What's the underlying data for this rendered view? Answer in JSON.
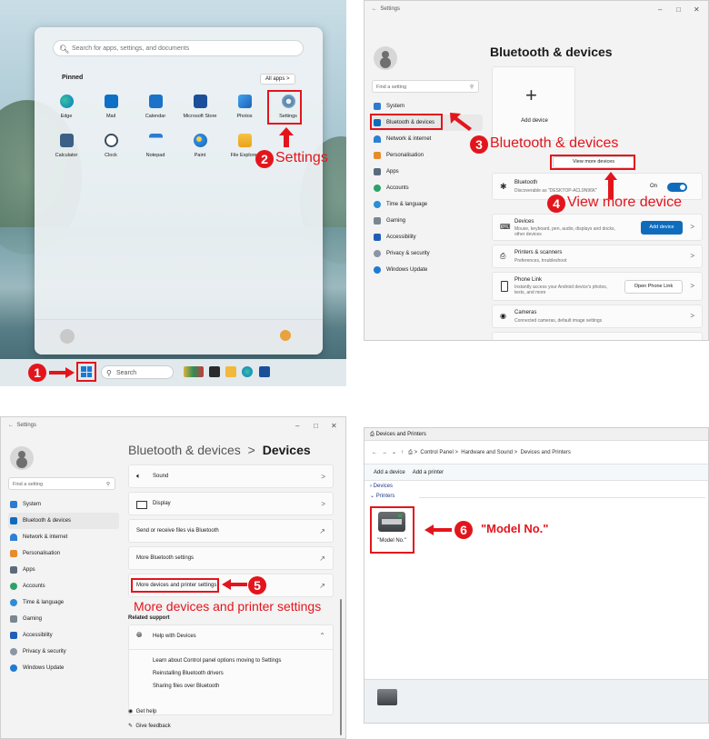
{
  "colors": {
    "accent": "#e3151c",
    "windows_blue": "#0f6cbd",
    "link_blue": "#0067c0"
  },
  "step1": {
    "start_search_placeholder": "Search for apps, settings, and documents",
    "pinned_label": "Pinned",
    "all_apps_label": "All apps",
    "pinned_apps": [
      "Edge",
      "Mail",
      "Calendar",
      "Microsoft Store",
      "Photos",
      "Settings",
      "Calculator",
      "Clock",
      "Notepad",
      "Paint",
      "File Explorer"
    ],
    "taskbar_search": "Search",
    "badge_1": "1",
    "badge_2": "2",
    "callout_2": "Settings"
  },
  "step2": {
    "window_title": "Settings",
    "page_title": "Bluetooth & devices",
    "find_setting_placeholder": "Find a setting",
    "nav_items": [
      "System",
      "Bluetooth & devices",
      "Network & internet",
      "Personalisation",
      "Apps",
      "Accounts",
      "Time & language",
      "Gaming",
      "Accessibility",
      "Privacy & security",
      "Windows Update"
    ],
    "add_device_tile": "Add device",
    "view_more_devices": "View more devices",
    "bluetooth_title": "Bluetooth",
    "bluetooth_sub": "Discoverable as \"DESKTOP-ACL9N96K\"",
    "bluetooth_state": "On",
    "devices_title": "Devices",
    "devices_sub": "Mouse, keyboard, pen, audio, displays and docks, other devices",
    "add_device_button": "Add device",
    "printers_title": "Printers & scanners",
    "printers_sub": "Preferences, troubleshoot",
    "phone_title": "Phone Link",
    "phone_sub": "Instantly access your Android device's photos, texts, and more",
    "open_phone_link": "Open Phone Link",
    "cameras_title": "Cameras",
    "cameras_sub": "Connected cameras, default image settings",
    "badge_3": "3",
    "callout_3": "Bluetooth & devices",
    "badge_4": "4",
    "callout_4": "View more device"
  },
  "step3": {
    "window_title": "Settings",
    "breadcrumb_parent": "Bluetooth & devices",
    "breadcrumb_sep": ">",
    "breadcrumb_current": "Devices",
    "find_setting_placeholder": "Find a setting",
    "nav_items": [
      "System",
      "Bluetooth & devices",
      "Network & internet",
      "Personalisation",
      "Apps",
      "Accounts",
      "Time & language",
      "Gaming",
      "Accessibility",
      "Privacy & security",
      "Windows Update"
    ],
    "rows": [
      "Sound",
      "Display",
      "Send or receive files via Bluetooth",
      "More Bluetooth settings",
      "More devices and printer settings"
    ],
    "related_support": "Related support",
    "help_with_devices": "Help with Devices",
    "help_links": [
      "Learn about Control panel options moving to Settings",
      "Reinstalling Bluetooth drivers",
      "Sharing files over Bluetooth"
    ],
    "get_help": "Get help",
    "give_feedback": "Give feedback",
    "badge_5": "5",
    "callout_5": "More devices and printer settings"
  },
  "step4": {
    "window_title": "Devices and Printers",
    "path": [
      "Control Panel",
      "Hardware and Sound",
      "Devices and Printers"
    ],
    "toolbar": [
      "Add a device",
      "Add a printer"
    ],
    "group_devices": "Devices",
    "group_printers": "Printers",
    "printer_name": "\"Model No.\"",
    "badge_6": "6",
    "callout_6": "\"Model No.\""
  }
}
